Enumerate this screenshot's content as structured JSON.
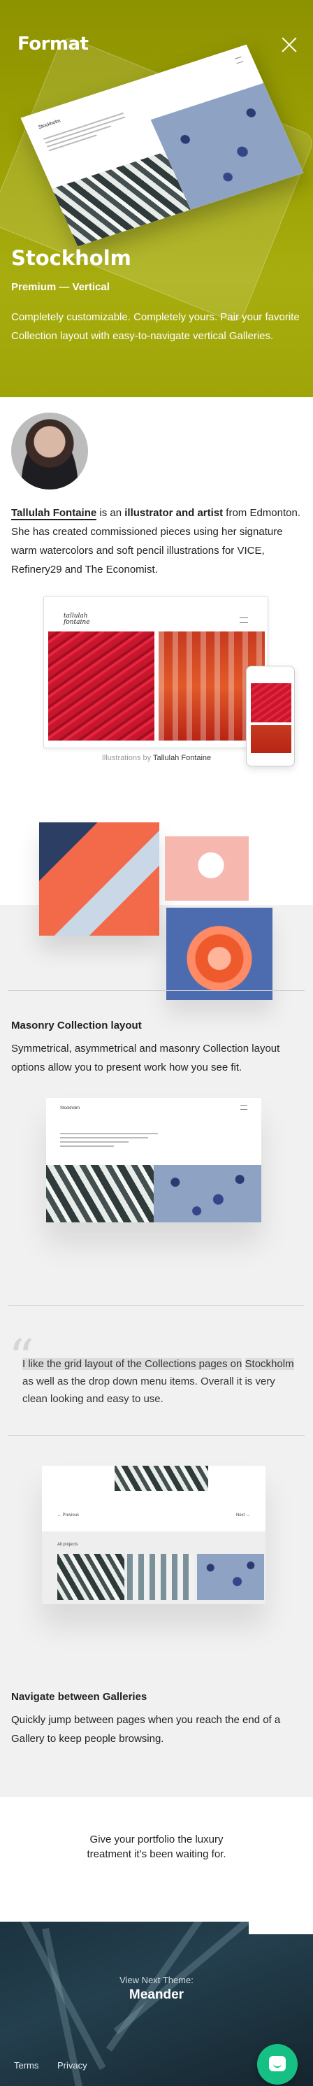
{
  "header": {
    "logo": "Format",
    "close_icon": "close-icon"
  },
  "hero": {
    "title": "Stockholm",
    "subtitle": "Premium — Vertical",
    "description": "Completely customizable. Completely yours. Pair your favorite Collection layout with easy-to-navigate vertical Galleries.",
    "background_color": "#9ea305",
    "preview_name": "Stockholm"
  },
  "artist": {
    "name": "Tallulah Fontaine",
    "text_is_an": " is an ",
    "role": "illustrator and artist",
    "text_rest": " from Edmonton. She has created commissioned pieces using her signature warm watercolors and soft pencil illustrations for VICE, Refinery29 and The Economist.",
    "preview_logo": "tallulah fontaine",
    "caption_prefix": "Illustrations by ",
    "caption_credit": "Tallulah Fontaine"
  },
  "masonry": {
    "title": "Masonry Collection layout",
    "description": "Symmetrical, asymmetrical and masonry Collection layout options allow you to present work how you see fit.",
    "preview_name": "Stockholm"
  },
  "testimonial": {
    "highlight_1": "I like the grid layout of the Collections pages on",
    "highlight_2": "Stockholm",
    "rest": " as well as the drop down menu items. Overall it is very clean looking and easy to use."
  },
  "navigate": {
    "title": "Navigate between Galleries",
    "description": "Quickly jump between pages when you reach the end of a Gallery to keep people browsing.",
    "prev_label": "← Previous",
    "next_label": "Next →",
    "all_projects_label": "All projects"
  },
  "cta": {
    "text_line1": "Give your portfolio the luxury",
    "text_line2": "treatment it’s been waiting for."
  },
  "footer": {
    "view_next_label": "View Next Theme:",
    "next_theme": "Meander",
    "links": [
      "Terms",
      "Privacy"
    ],
    "chat_icon": "chat-bubble-icon",
    "chat_color": "#16c085"
  }
}
